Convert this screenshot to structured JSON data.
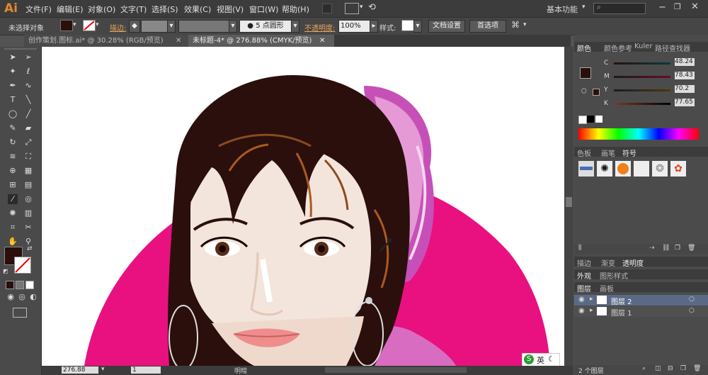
{
  "app": {
    "logo": "Ai"
  },
  "menu": [
    "文件(F)",
    "编辑(E)",
    "对象(O)",
    "文字(T)",
    "选择(S)",
    "效果(C)",
    "视图(V)",
    "窗口(W)",
    "帮助(H)"
  ],
  "workspace": {
    "label": "基本功能"
  },
  "control": {
    "selection_label": "未选择对象",
    "stroke_label": "描边:",
    "brush_label": "5 点圆形",
    "opacity_label": "不透明度:",
    "opacity_value": "100%",
    "style_label": "样式:",
    "doc_setup": "文档设置",
    "preferences": "首选项"
  },
  "tabs": [
    {
      "label": "创作策划.图标.ai* @ 30.28% (RGB/预览)",
      "active": false
    },
    {
      "label": "未标题-4* @ 276.88% (CMYK/预览)",
      "active": true
    }
  ],
  "colors": {
    "fill": "#2a0f0a",
    "magenta": "#e8117f",
    "hair": "#2b0f0c",
    "skin": "#f3e5dc",
    "panel_bg": "#4b4b4b"
  },
  "color_panel": {
    "tabs": [
      "颜色",
      "颜色参考",
      "Kuler",
      "路径查找器"
    ],
    "channels": [
      {
        "name": "C",
        "value": "48.24"
      },
      {
        "name": "M",
        "value": "78.43"
      },
      {
        "name": "Y",
        "value": "70.2"
      },
      {
        "name": "K",
        "value": "77.65"
      }
    ]
  },
  "symbols_panel": {
    "tabs": [
      "色板",
      "画笔",
      "符号"
    ]
  },
  "transparency_panel": {
    "tabs": [
      "描边",
      "渐变",
      "透明度"
    ]
  },
  "appearance_panel": {
    "tabs": [
      "外观",
      "图形样式"
    ]
  },
  "layers_panel": {
    "tabs": [
      "图层",
      "画板"
    ],
    "layers": [
      {
        "name": "图层 2"
      },
      {
        "name": "图层 1"
      }
    ],
    "count_label": "2 个图层"
  },
  "status": {
    "zoom": "276.88",
    "page": "1",
    "mode": "明暗"
  },
  "ime": {
    "label": "英"
  }
}
